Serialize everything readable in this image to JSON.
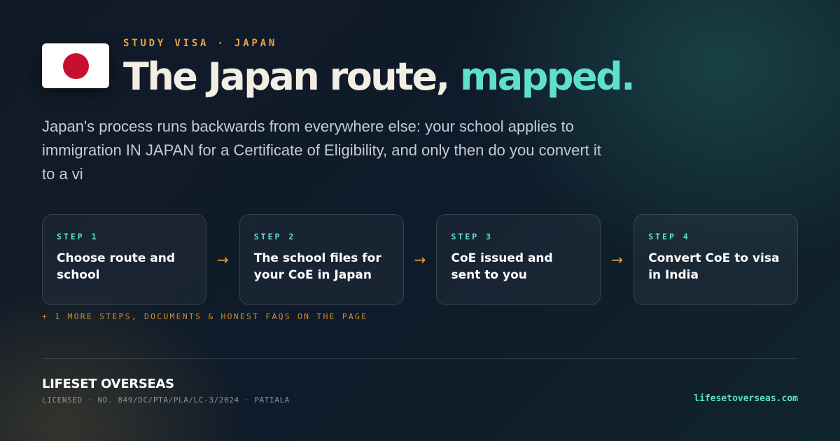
{
  "header": {
    "flag_icon": "japan-flag-icon",
    "eyebrow": "STUDY VISA · JAPAN",
    "title_main": "The Japan route, ",
    "title_accent": "mapped."
  },
  "intro": {
    "text": "Japan's process runs backwards from everywhere else: your school applies to immigration IN JAPAN for a Certificate of Eligibility, and only then do you convert it to a vi"
  },
  "steps": [
    {
      "label": "STEP 1",
      "title": "Choose route and school"
    },
    {
      "label": "STEP 2",
      "title": "The school files for your CoE in Japan"
    },
    {
      "label": "STEP 3",
      "title": "CoE issued and sent to you"
    },
    {
      "label": "STEP 4",
      "title": "Convert CoE to visa in India"
    }
  ],
  "arrow_glyph": "→",
  "more_note": "+ 1 MORE STEPS, DOCUMENTS & HONEST FAQS ON THE PAGE",
  "footer": {
    "brand": "LIFESET OVERSEAS",
    "license": "LICENSED · NO. 849/DC/PTA/PLA/LC-3/2024 · PATIALA",
    "website": "lifesetoverseas.com"
  },
  "colors": {
    "accent_teal": "#5ee0cc",
    "accent_amber": "#e8a33a",
    "flag_red": "#c8102e",
    "background": "#0f1a28"
  }
}
